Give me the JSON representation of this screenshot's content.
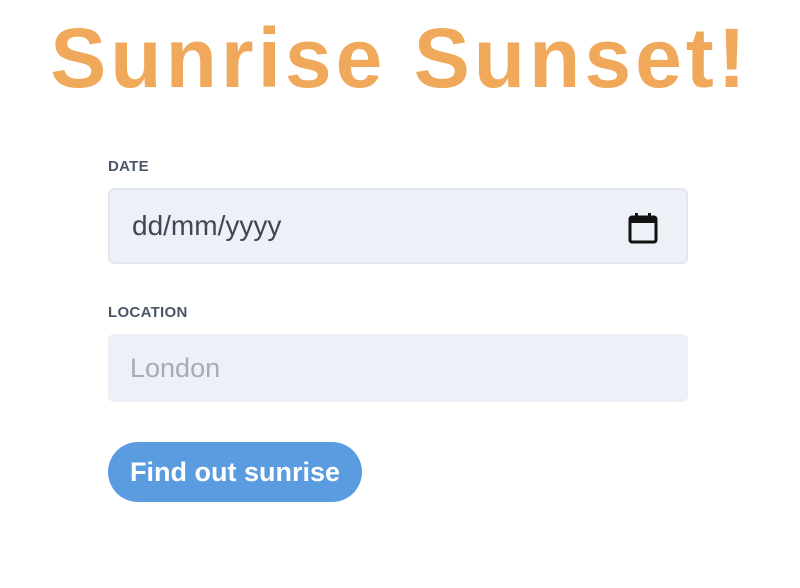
{
  "header": {
    "title": "Sunrise Sunset!"
  },
  "form": {
    "date": {
      "label": "DATE",
      "placeholder": "dd/mm/yyyy",
      "icon": "calendar-icon"
    },
    "location": {
      "label": "LOCATION",
      "placeholder": "London",
      "value": ""
    },
    "submit_label": "Find out sunrise"
  },
  "colors": {
    "title": "#f0a95a",
    "button": "#5b9be0",
    "input_background": "#edf1f7",
    "label": "#4a5568"
  }
}
